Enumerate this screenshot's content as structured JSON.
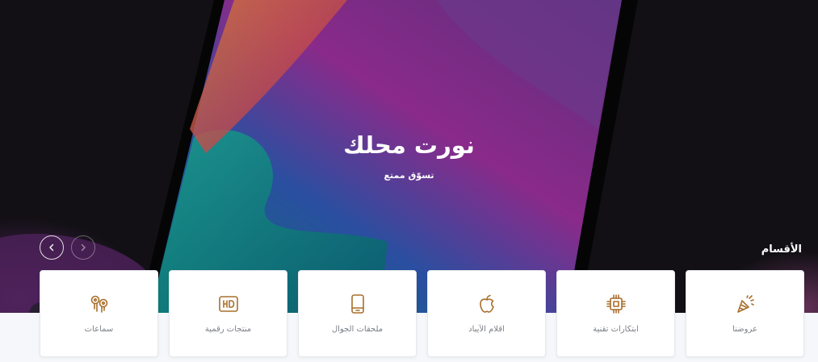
{
  "hero": {
    "title": "نورت محلك",
    "subtitle": "تسوّق ممتع"
  },
  "categories": {
    "title": "الأقسام",
    "items": [
      {
        "label": "عروضنا",
        "icon": "party-popper-icon"
      },
      {
        "label": "ابتكارات تقنية",
        "icon": "cpu-chip-icon"
      },
      {
        "label": "اقلام الآيباد",
        "icon": "apple-icon"
      },
      {
        "label": "ملحقات الجوال",
        "icon": "phone-icon"
      },
      {
        "label": "منتجات رقمية",
        "icon": "hd-icon"
      },
      {
        "label": "سماعات",
        "icon": "earbuds-icon"
      }
    ]
  },
  "carousel": {
    "next_icon": "chevron-left-icon",
    "prev_icon": "chevron-right-icon"
  },
  "colors": {
    "icon": "#a86f2c",
    "hero_bg": "#0f0e12",
    "card_bg": "#ffffff",
    "label": "#7b7f87"
  }
}
